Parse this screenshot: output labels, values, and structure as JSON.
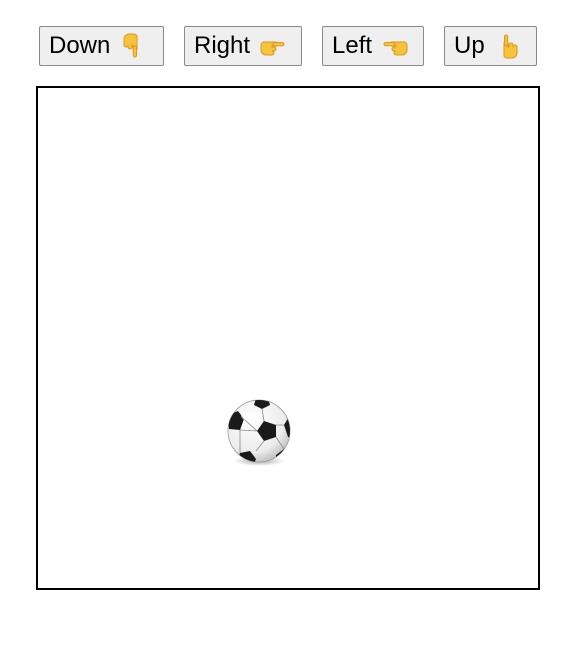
{
  "controls": {
    "down": {
      "label": "Down",
      "icon": "hand-pointing-down-icon"
    },
    "right": {
      "label": "Right",
      "icon": "hand-pointing-right-icon"
    },
    "left": {
      "label": "Left",
      "icon": "hand-pointing-left-icon"
    },
    "up": {
      "label": "Up",
      "icon": "hand-pointing-up-icon"
    }
  },
  "field": {
    "ball_icon": "soccer-ball-icon"
  },
  "colors": {
    "button_bg": "#efefef",
    "button_border": "#8a8a8a",
    "hand": "#f7c23c",
    "field_border": "#000000",
    "ball_dark": "#1a1a1a"
  }
}
